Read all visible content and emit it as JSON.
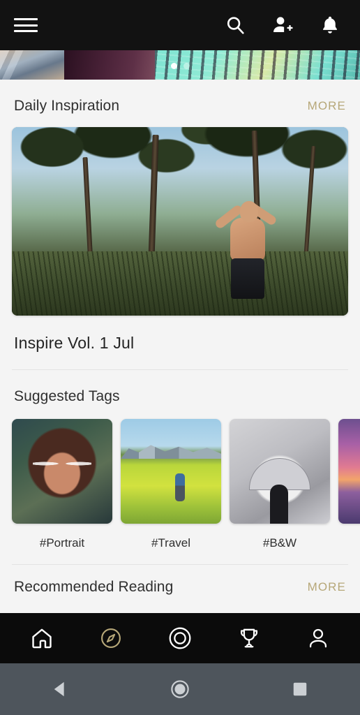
{
  "appbar": {
    "menu_icon": "hamburger-menu-icon",
    "actions": [
      {
        "name": "search-icon",
        "label": "Search"
      },
      {
        "name": "add-person-icon",
        "label": "Add friend"
      },
      {
        "name": "bell-icon",
        "label": "Notifications"
      }
    ]
  },
  "carousel": {
    "slide_count": 2,
    "active_index": 0
  },
  "sections": {
    "daily_inspiration": {
      "title": "Daily Inspiration",
      "more_label": "MORE",
      "card_title": "Inspire Vol. 1 Jul"
    },
    "suggested_tags": {
      "title": "Suggested Tags",
      "tags": [
        {
          "label": "#Portrait"
        },
        {
          "label": "#Travel"
        },
        {
          "label": "#B&W"
        },
        {
          "label": ""
        }
      ]
    },
    "recommended_reading": {
      "title": "Recommended Reading",
      "more_label": "MORE"
    }
  },
  "bottom_nav": {
    "active_index": 1,
    "items": [
      {
        "name": "home-icon",
        "label": "Home"
      },
      {
        "name": "compass-icon",
        "label": "Explore"
      },
      {
        "name": "camera-shutter-icon",
        "label": "Capture"
      },
      {
        "name": "trophy-icon",
        "label": "Awards"
      },
      {
        "name": "profile-icon",
        "label": "Profile"
      }
    ]
  },
  "system_nav": {
    "items": [
      {
        "name": "android-back-icon",
        "label": "Back"
      },
      {
        "name": "android-home-icon",
        "label": "Home"
      },
      {
        "name": "android-recents-icon",
        "label": "Recents"
      }
    ]
  },
  "colors": {
    "accent_gold": "#b6a778",
    "appbar_bg": "#121212",
    "page_bg": "#f4f4f4",
    "bottomnav_bg": "#0b0b0b",
    "systembar_bg": "#4e555c",
    "text_primary": "#2f2f2f"
  }
}
